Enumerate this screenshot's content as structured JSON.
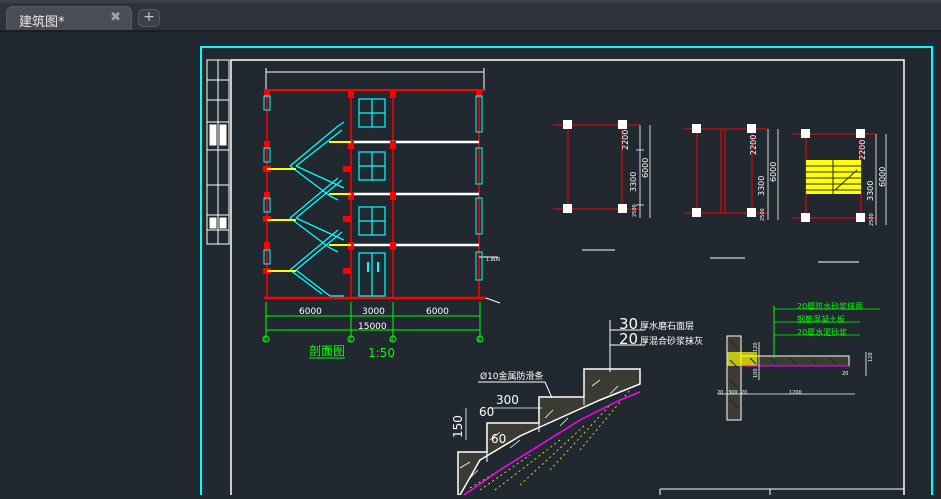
{
  "tabs": [
    {
      "label": "建筑图*",
      "close": "✖"
    }
  ],
  "new_tab": "+",
  "section": {
    "dims_bottom": [
      "6000",
      "3000",
      "6000"
    ],
    "dim_total": "15000",
    "axes": [
      "①",
      "②",
      "③",
      "④"
    ],
    "title": "剖面图",
    "scale": "1:50",
    "side_label": "1.800"
  },
  "plans": {
    "dims": [
      "2200",
      "3300",
      "6000",
      "2500"
    ]
  },
  "stair_detail": {
    "note1_num": "30",
    "note1_text": "厚水磨石面层",
    "note2_num": "20",
    "note2_text": "厚混合砂浆抹灰",
    "rod": "Ø10金属防滑条",
    "tread": "300",
    "nosing1": "60",
    "nosing2": "60",
    "riser": "150"
  },
  "landing_detail": {
    "notes": [
      "20厚防水砂浆抹面",
      "钢筋混凝土板",
      "20厚水泥砂浆"
    ],
    "dims": [
      "20",
      "300",
      "20",
      "1200",
      "120",
      "20",
      "100",
      "120"
    ]
  },
  "colors": {
    "background": "#212830",
    "cyan": "#00ffff",
    "red": "#ff0000",
    "yellow": "#ffff00",
    "green": "#00ff00",
    "white": "#ffffff",
    "magenta": "#ff00ff"
  }
}
